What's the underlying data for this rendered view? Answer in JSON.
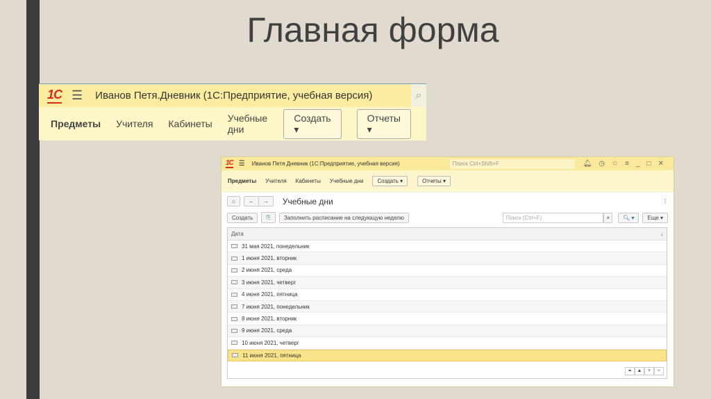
{
  "slide_title": "Главная форма",
  "crop": {
    "logo": "1С",
    "app_title": "Иванов Петя.Дневник  (1С:Предприятие, учебная версия)",
    "nav": [
      "Предметы",
      "Учителя",
      "Кабинеты",
      "Учебные дни"
    ],
    "create_label": "Создать ▾",
    "reports_label": "Отчеты ▾"
  },
  "window": {
    "logo": "1С",
    "app_title": "Иванов Петя Дневник  (1С:Предприятие, учебная версия)",
    "search_placeholder": "Поиск Ctrl+Shift+F",
    "nav": [
      "Предметы",
      "Учителя",
      "Кабинеты",
      "Учебные дни"
    ],
    "create_label": "Создать ▾",
    "reports_label": "Отчеты ▾",
    "form_title": "Учебные дни",
    "toolbar": {
      "create": "Создать",
      "fill": "Заполнить расписание на следующую неделю",
      "search_placeholder": "Поиск (Ctrl+F)",
      "more": "Еще ▾"
    },
    "table": {
      "column": "Дата",
      "rows": [
        "31 мая 2021, понедельник",
        "1 июня 2021, вторник",
        "2 июня 2021, среда",
        "3 июня 2021, четверг",
        "4 июня 2021, пятница",
        "7 июня 2021, понедельник",
        "8 июня 2021, вторник",
        "9 июня 2021, среда",
        "10 июня 2021, четверг",
        "11 июня 2021, пятница"
      ],
      "selected_index": 9
    }
  }
}
